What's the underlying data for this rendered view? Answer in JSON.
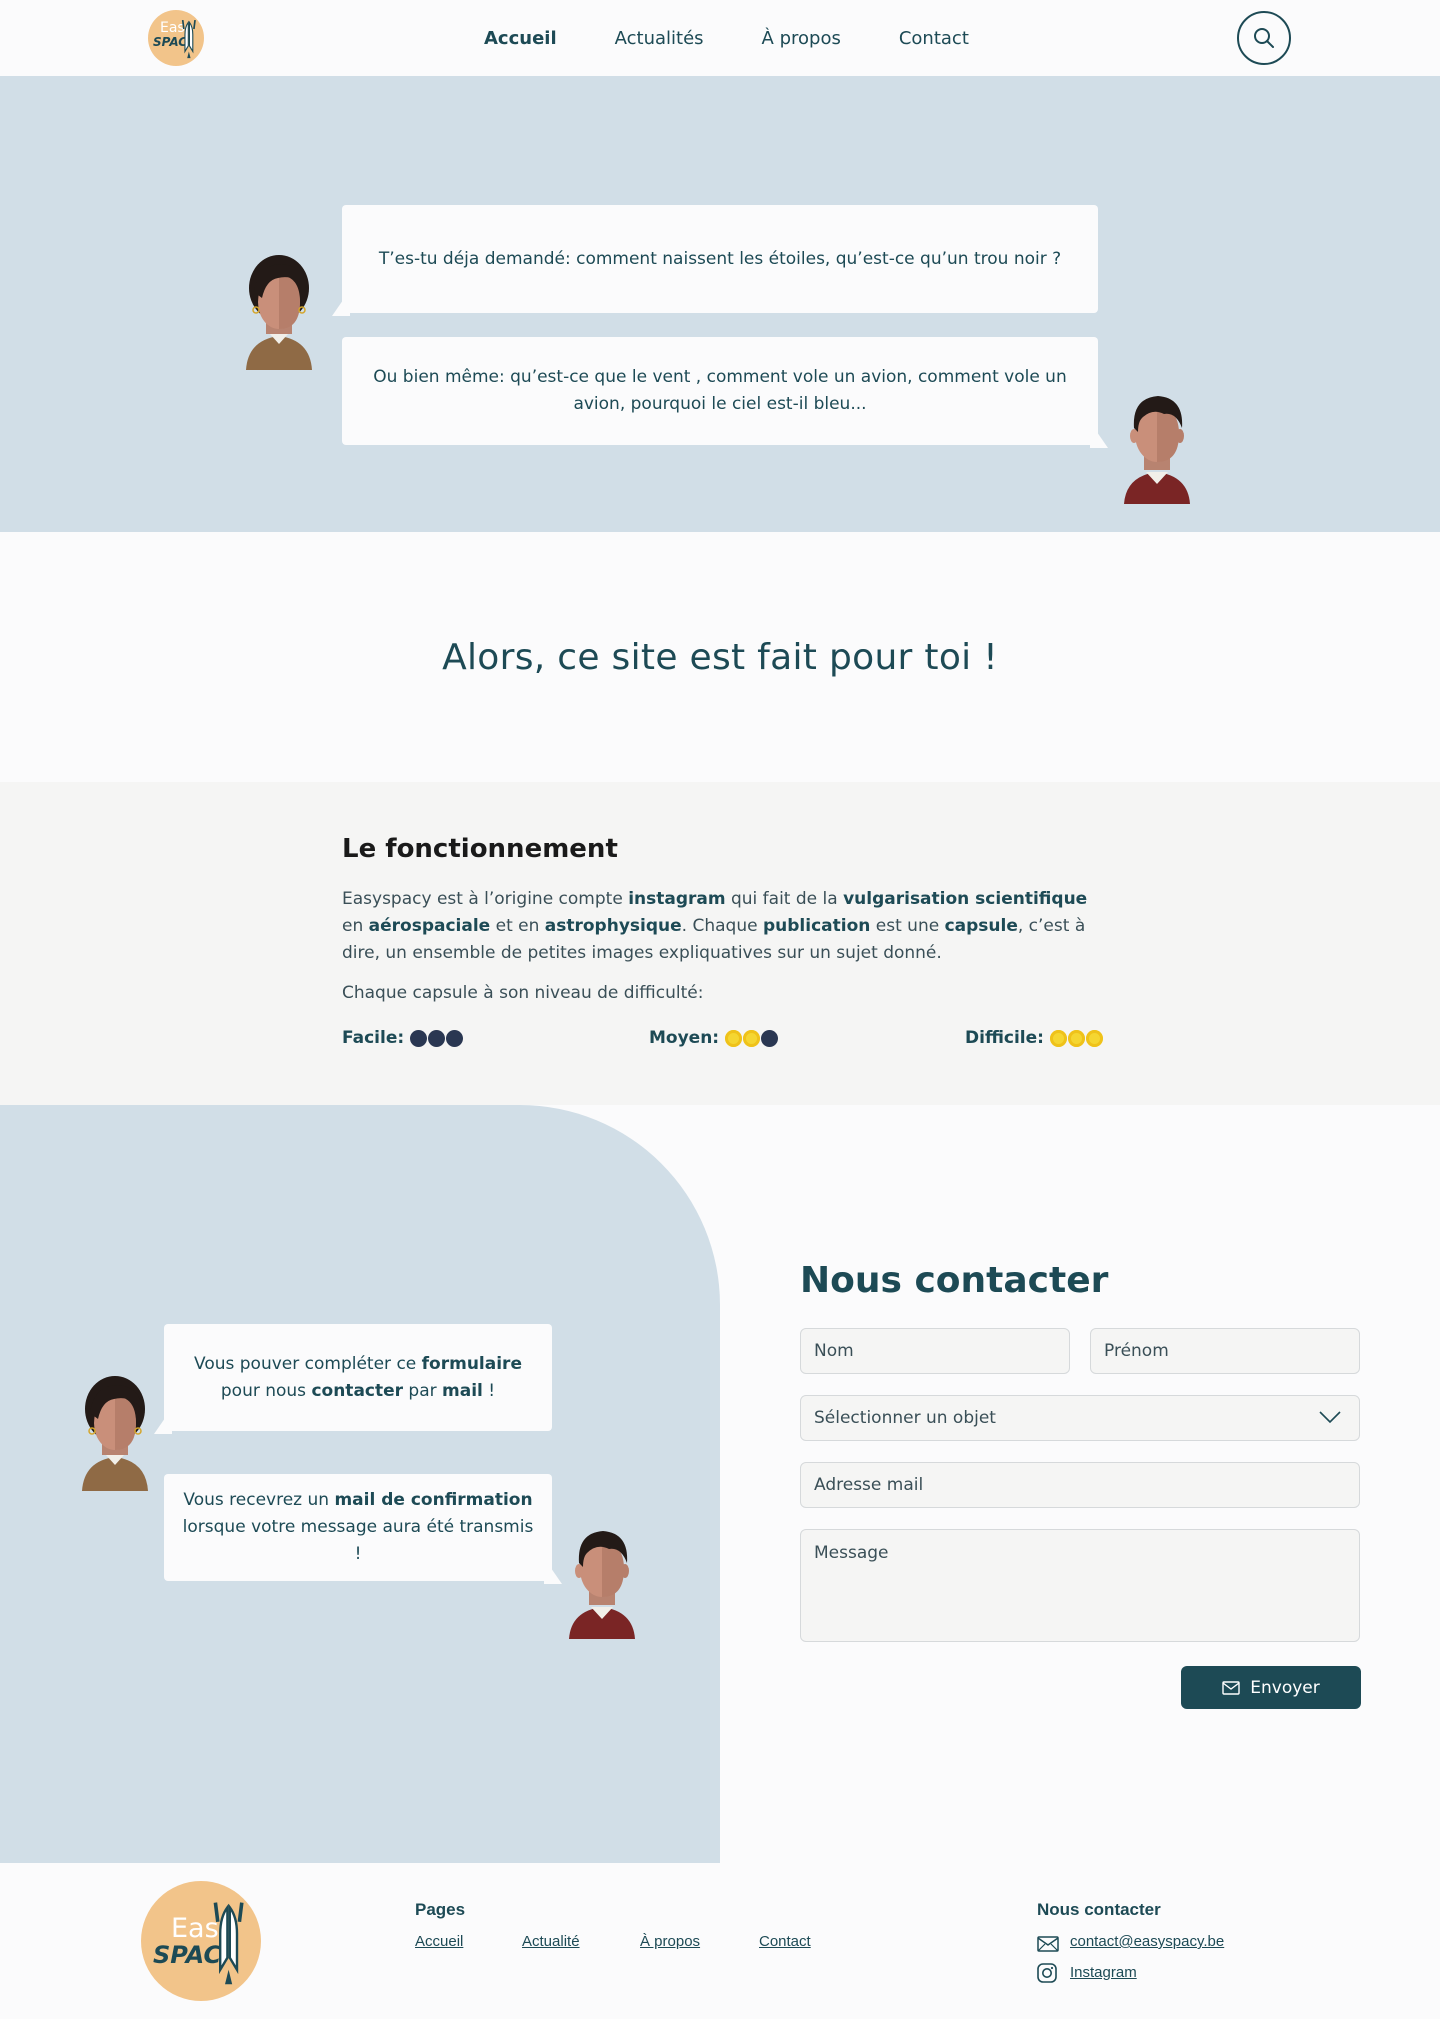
{
  "header": {
    "logo_text_top": "Eas",
    "logo_text_bottom": "SPAC",
    "nav": [
      {
        "label": "Accueil",
        "active": true
      },
      {
        "label": "Actualités",
        "active": false
      },
      {
        "label": "À propos",
        "active": false
      },
      {
        "label": "Contact",
        "active": false
      }
    ],
    "search_icon": "search-icon"
  },
  "hero": {
    "bubble_1": "T’es-tu déja demandé: comment naissent les étoiles, qu’est-ce qu’un trou noir ?",
    "bubble_2": "Ou bien même: qu’est-ce que le vent , comment vole un avion, comment vole un avion, pourquoi le ciel est-il bleu..."
  },
  "tagline": "Alors, ce site est fait pour toi !",
  "how": {
    "title": "Le fonctionnement",
    "p1": {
      "t1": "Easyspacy est à l’origine compte ",
      "b1": "instagram",
      "t2": " qui fait de la ",
      "b2": "vulgarisation scientifique",
      "t3": " en ",
      "b3": "aérospaciale",
      "t4": " et en ",
      "b4": "astrophysique",
      "t5": ". Chaque ",
      "b5": "publication",
      "t6": " est une ",
      "b6": "capsule",
      "t7": ", c’est à dire, un ensemble de petites images expliquatives sur un sujet donné."
    },
    "p2": "Chaque capsule à son niveau de difficulté:",
    "levels": [
      {
        "label": "Facile:",
        "filled": 0
      },
      {
        "label": "Moyen:",
        "filled": 2
      },
      {
        "label": "Difficile:",
        "filled": 3
      }
    ]
  },
  "contact": {
    "bubble_1": {
      "t1": "Vous pouver compléter ce ",
      "b1": "formulaire",
      "t2": " pour nous ",
      "b2": "contacter",
      "t3": " par ",
      "b3": "mail",
      "t4": " !"
    },
    "bubble_2": {
      "t1": "Vous recevrez un ",
      "b1": "mail de confirmation",
      "t2": " lorsque votre message aura été transmis !"
    },
    "title": "Nous contacter",
    "fields": {
      "nom": "Nom",
      "prenom": "Prénom",
      "objet": "Sélectionner un objet",
      "email": "Adresse mail",
      "message": "Message"
    },
    "send_label": "Envoyer"
  },
  "footer": {
    "logo_text_top": "Eas",
    "logo_text_bottom": "SPAC",
    "pages_heading": "Pages",
    "pages": [
      "Accueil",
      "Actualité",
      "À propos",
      "Contact"
    ],
    "contact_heading": "Nous contacter",
    "email": "contact@easyspacy.be",
    "instagram": "Instagram"
  },
  "colors": {
    "primary": "#1d4a55",
    "light_blue": "#d1dee7",
    "logo_orange": "#f2c48a",
    "easy_dot": "#2a3752",
    "hard_dot": "#f5d631"
  }
}
